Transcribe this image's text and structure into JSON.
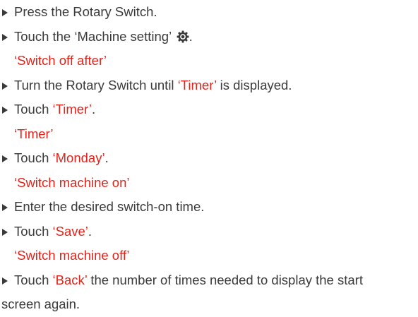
{
  "instructions": [
    {
      "type": "step",
      "parts": [
        {
          "t": "Press the Rotary Switch."
        }
      ]
    },
    {
      "type": "step",
      "parts": [
        {
          "t": "Touch the ‘Machine setting’ "
        },
        {
          "icon": "gear-icon"
        },
        {
          "t": "."
        }
      ]
    },
    {
      "type": "result",
      "parts": [
        {
          "t": "‘Switch off after’",
          "red": true
        }
      ]
    },
    {
      "type": "step",
      "parts": [
        {
          "t": "Turn the Rotary Switch until "
        },
        {
          "t": "‘Timer’",
          "red": true
        },
        {
          "t": " is displayed."
        }
      ]
    },
    {
      "type": "step",
      "parts": [
        {
          "t": "Touch "
        },
        {
          "t": "‘Timer’",
          "red": true
        },
        {
          "t": "."
        }
      ]
    },
    {
      "type": "result",
      "parts": [
        {
          "t": "‘Timer’",
          "red": true
        }
      ]
    },
    {
      "type": "step",
      "parts": [
        {
          "t": "Touch "
        },
        {
          "t": "‘Monday’",
          "red": true
        },
        {
          "t": "."
        }
      ]
    },
    {
      "type": "result",
      "parts": [
        {
          "t": "‘Switch machine on’",
          "red": true
        }
      ]
    },
    {
      "type": "step",
      "parts": [
        {
          "t": "Enter the desired switch-on time."
        }
      ]
    },
    {
      "type": "step",
      "parts": [
        {
          "t": "Touch "
        },
        {
          "t": "‘Save’",
          "red": true
        },
        {
          "t": "."
        }
      ]
    },
    {
      "type": "result",
      "parts": [
        {
          "t": "‘Switch machine off’",
          "red": true
        }
      ]
    },
    {
      "type": "step",
      "parts": [
        {
          "t": "Touch "
        },
        {
          "t": "‘Back’",
          "red": true
        },
        {
          "t": " the number of times needed to display the start"
        }
      ]
    },
    {
      "type": "cont",
      "parts": [
        {
          "t": "screen again."
        }
      ]
    }
  ],
  "colors": {
    "text": "#3a3a3a",
    "accent": "#e2231a"
  }
}
